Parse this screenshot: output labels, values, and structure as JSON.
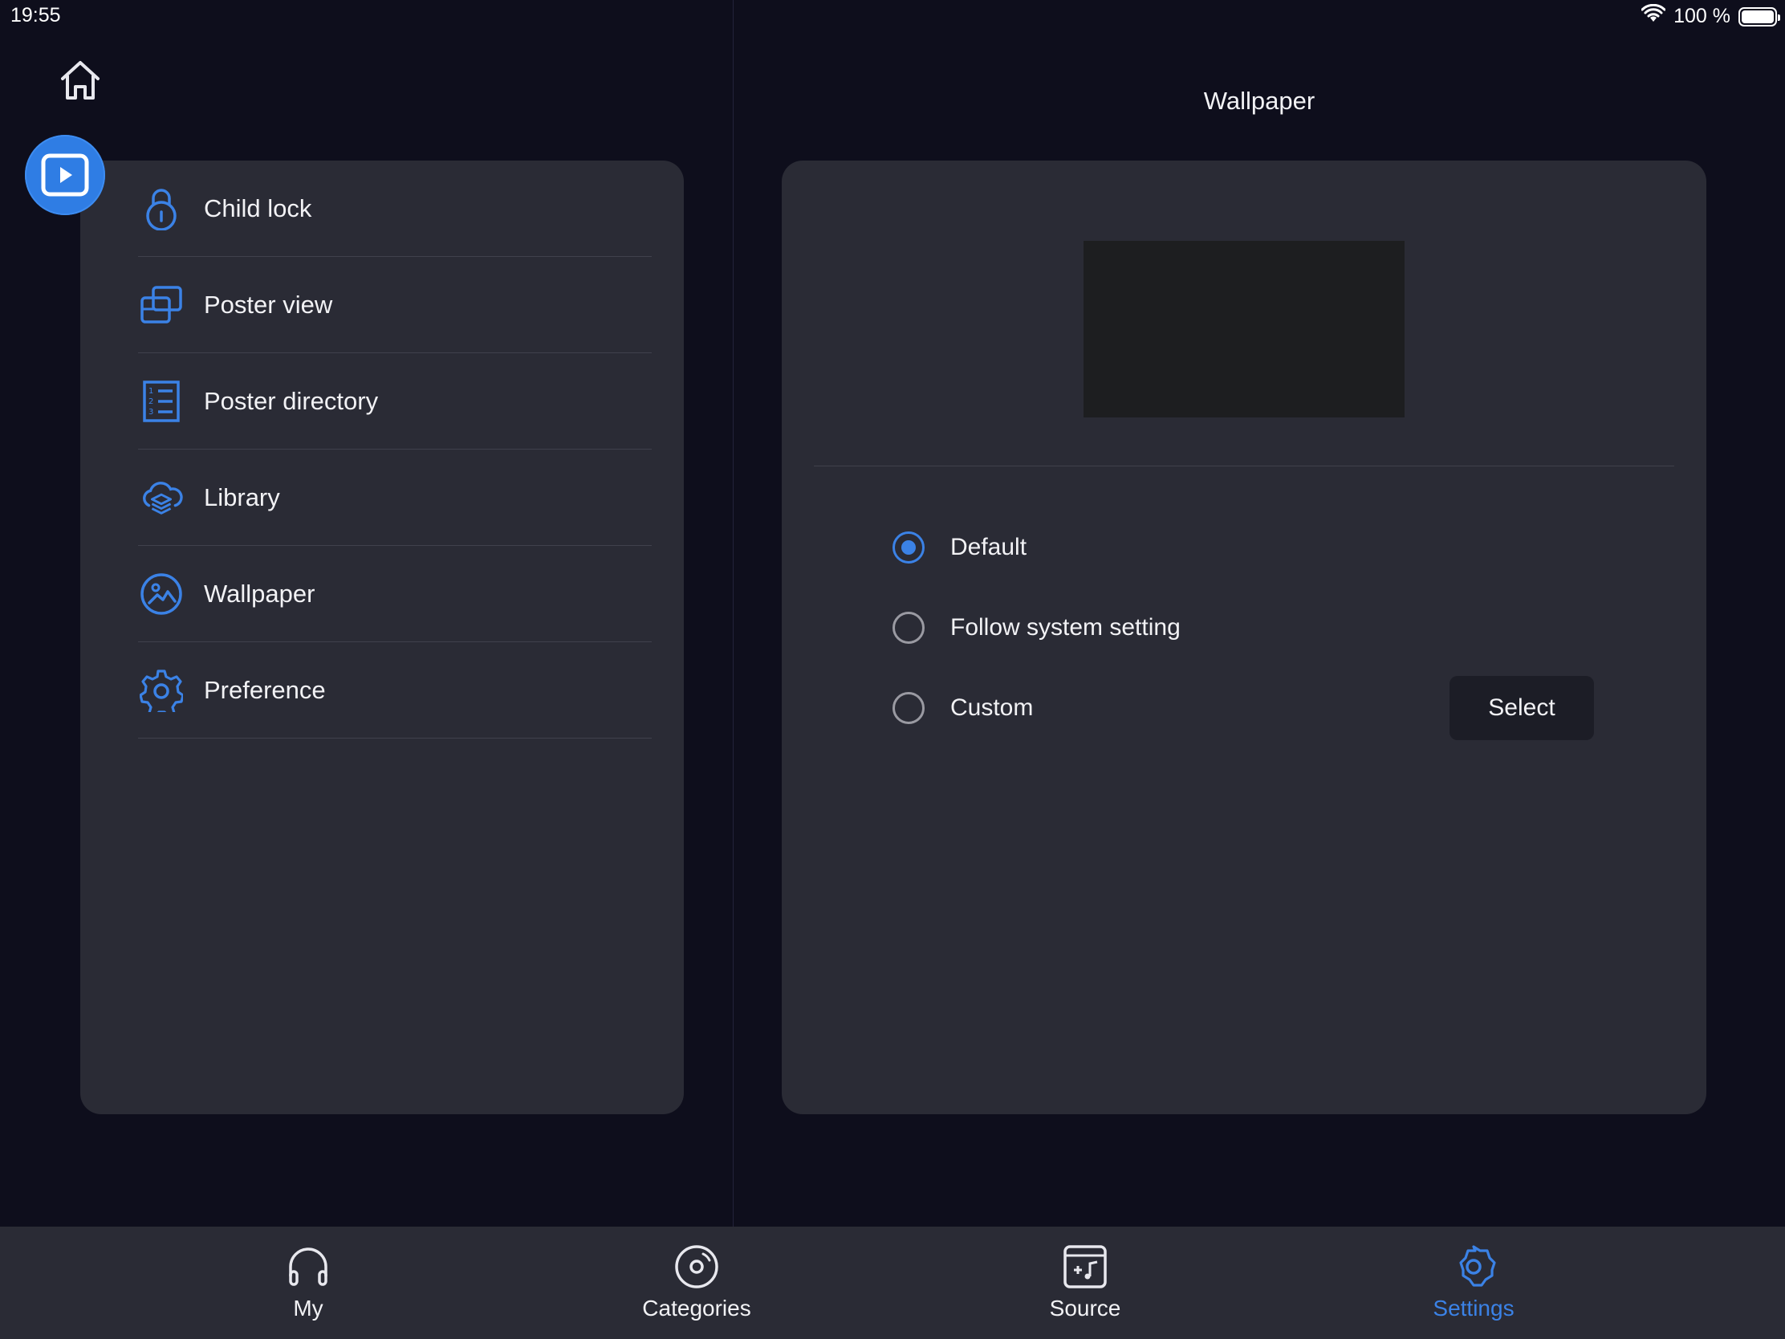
{
  "status_bar": {
    "time": "19:55",
    "battery": "100 %"
  },
  "menu": {
    "items": [
      {
        "label": "Child lock",
        "icon": "lock-icon"
      },
      {
        "label": "Poster view",
        "icon": "poster-view-icon"
      },
      {
        "label": "Poster directory",
        "icon": "list-icon"
      },
      {
        "label": "Library",
        "icon": "cloud-layers-icon"
      },
      {
        "label": "Wallpaper",
        "icon": "image-icon"
      },
      {
        "label": "Preference",
        "icon": "gear-icon"
      }
    ]
  },
  "detail": {
    "title": "Wallpaper",
    "options": [
      {
        "label": "Default",
        "checked": true
      },
      {
        "label": "Follow system setting",
        "checked": false
      },
      {
        "label": "Custom",
        "checked": false
      }
    ],
    "select_label": "Select"
  },
  "tabs": [
    {
      "label": "My",
      "icon": "headphones-icon"
    },
    {
      "label": "Categories",
      "icon": "disc-icon"
    },
    {
      "label": "Source",
      "icon": "music-box-icon"
    },
    {
      "label": "Settings",
      "icon": "gear-icon",
      "active": true
    }
  ],
  "colors": {
    "accent": "#3b82e6",
    "background": "#0e0e1c",
    "panel": "#2a2b35"
  }
}
